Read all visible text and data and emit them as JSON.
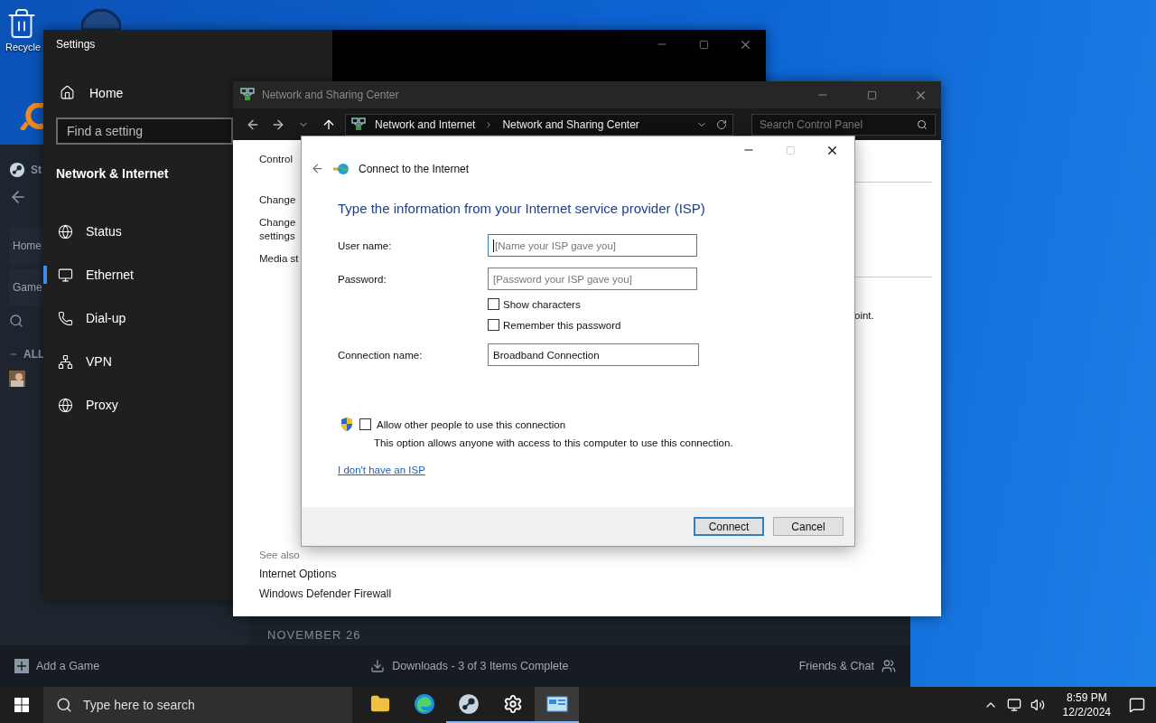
{
  "desktop_icons": [
    {
      "label": "Recycle"
    }
  ],
  "steam": {
    "sidebar": {
      "title": "St",
      "tabs": [
        {
          "label": "Home"
        },
        {
          "label": "Game"
        }
      ],
      "section": "ALL"
    },
    "date_header": "NOVEMBER 26",
    "footer": {
      "add_game": "Add a Game",
      "downloads": "Downloads - 3 of 3 Items Complete",
      "friends": "Friends & Chat"
    }
  },
  "settings": {
    "title": "Settings",
    "home": "Home",
    "search": {
      "placeholder": "Find a setting"
    },
    "section": "Network & Internet",
    "nav": [
      {
        "label": "Status",
        "kind": "status",
        "selected": false
      },
      {
        "label": "Ethernet",
        "kind": "ethernet",
        "selected": true
      },
      {
        "label": "Dial-up",
        "kind": "dialup",
        "selected": false
      },
      {
        "label": "VPN",
        "kind": "vpn",
        "selected": false
      },
      {
        "label": "Proxy",
        "kind": "proxy",
        "selected": false
      }
    ]
  },
  "network_center": {
    "title": "Network and Sharing Center",
    "breadcrumb": [
      "Network and Internet",
      "Network and Sharing Center"
    ],
    "search": {
      "placeholder": "Search Control Panel"
    },
    "tasks": [
      {
        "lines": [
          "Control"
        ]
      },
      {
        "lines": [
          "Change"
        ]
      },
      {
        "lines": [
          "Change",
          "settings"
        ]
      },
      {
        "lines": [
          "Media st"
        ]
      }
    ],
    "see_also": {
      "heading": "See also",
      "links": [
        "Internet Options",
        "Windows Defender Firewall"
      ]
    },
    "content_fragment": "oint."
  },
  "dialog": {
    "title": "Connect to the Internet",
    "heading": "Type the information from your Internet service provider (ISP)",
    "fields": [
      {
        "label": "User name:",
        "placeholder": "[Name your ISP gave you]",
        "focused": true
      },
      {
        "label": "Password:",
        "placeholder": "[Password your ISP gave you]",
        "focused": false
      }
    ],
    "checkboxes": [
      {
        "label": "Show characters",
        "checked": false
      },
      {
        "label": "Remember this password",
        "checked": false
      }
    ],
    "connection_name": {
      "label": "Connection name:",
      "value": "Broadband Connection"
    },
    "allow": {
      "label": "Allow other people to use this connection",
      "checked": false,
      "description": "This option allows anyone with access to this computer to use this connection."
    },
    "link": "I don't have an ISP",
    "buttons": [
      {
        "label": "Connect",
        "default": true
      },
      {
        "label": "Cancel",
        "default": false
      }
    ]
  },
  "taskbar": {
    "search": {
      "placeholder": "Type here to search"
    },
    "apps": [
      {
        "kind": "folder",
        "running": false,
        "active": false
      },
      {
        "kind": "browser",
        "running": false,
        "active": false
      },
      {
        "kind": "steam",
        "running": true,
        "active": false
      },
      {
        "kind": "gear",
        "running": true,
        "active": false
      },
      {
        "kind": "control-panel",
        "running": true,
        "active": true
      }
    ],
    "time": "8:59 PM",
    "date": "12/2/2024"
  }
}
